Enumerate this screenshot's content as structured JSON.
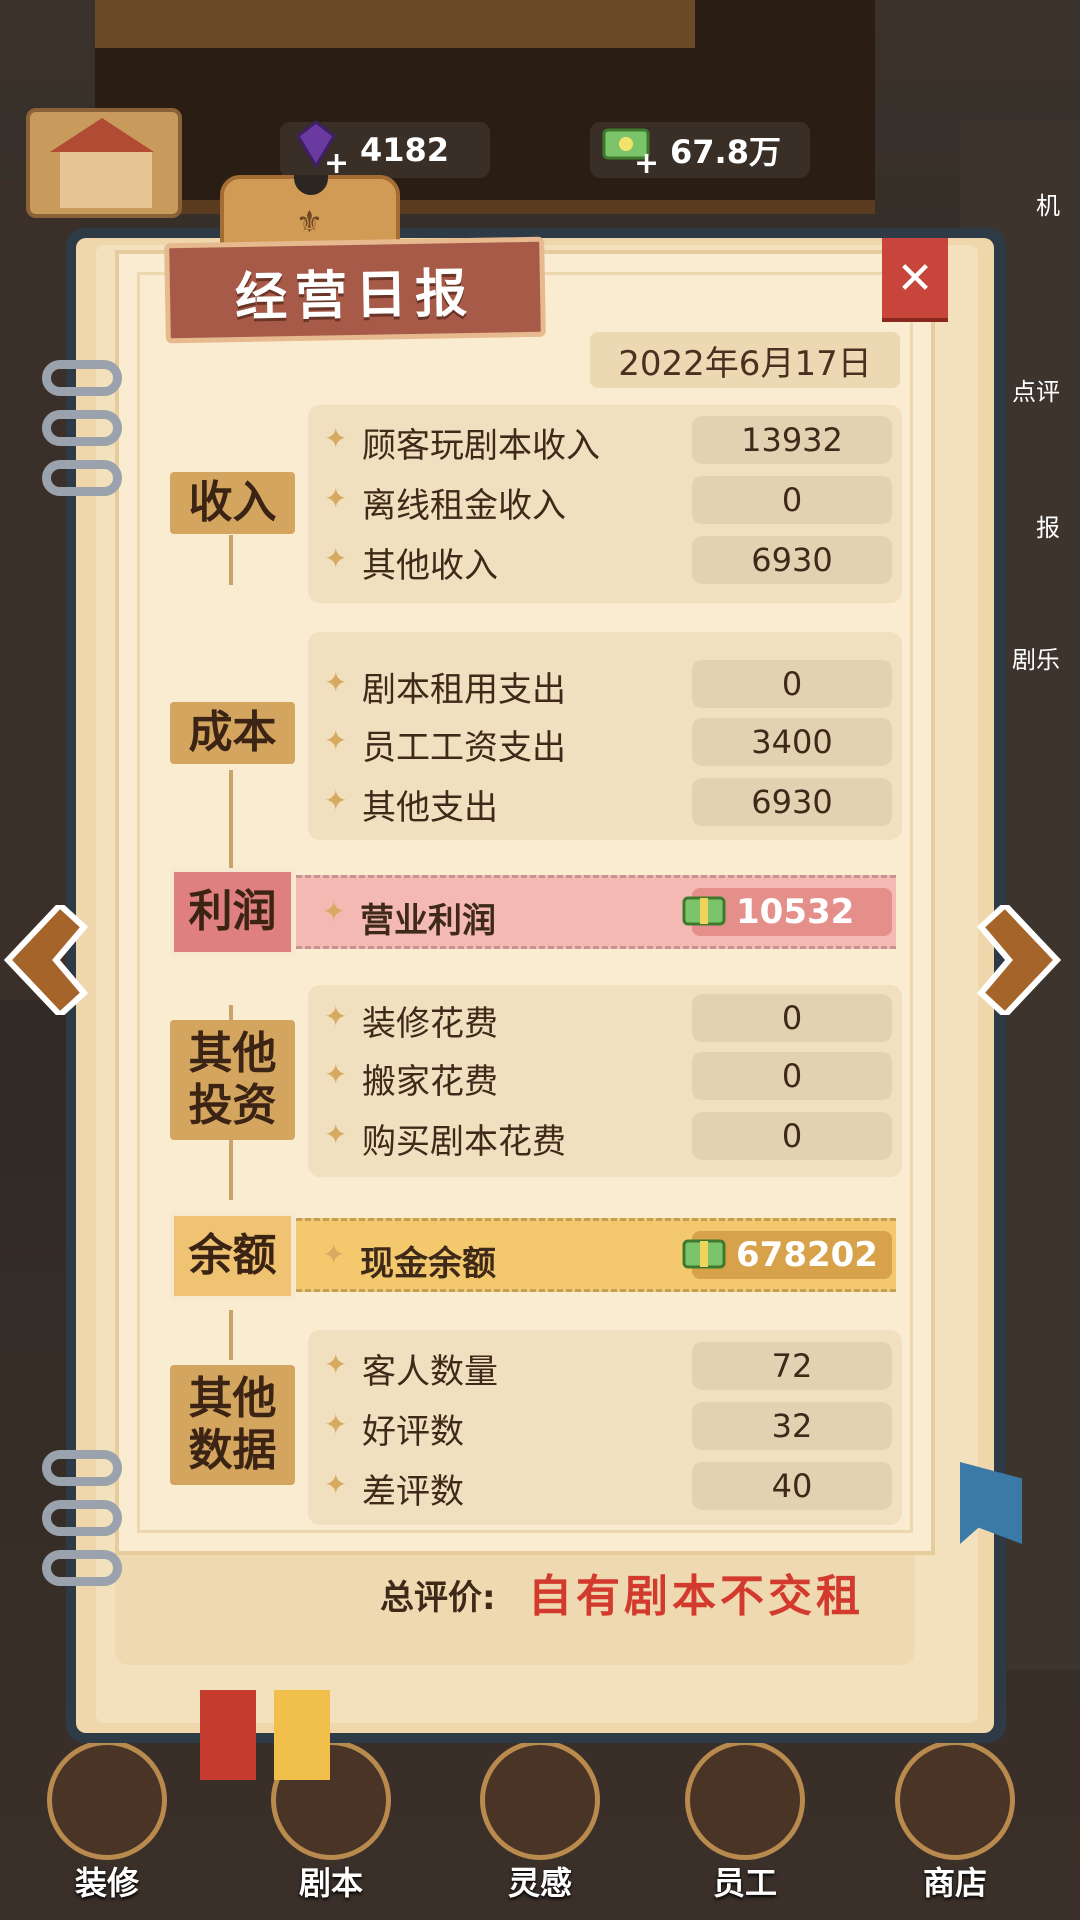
{
  "resources": {
    "gems": "4182",
    "cash": "67.8万"
  },
  "side_labels": [
    "机",
    "点评",
    "报",
    "剧乐"
  ],
  "report": {
    "title": "经营日报",
    "date": "2022年6月17日",
    "close_symbol": "✕",
    "sections": {
      "income": {
        "category": "收入",
        "rows": [
          {
            "label": "顾客玩剧本收入",
            "value": "13932"
          },
          {
            "label": "离线租金收入",
            "value": "0"
          },
          {
            "label": "其他收入",
            "value": "6930"
          }
        ]
      },
      "cost": {
        "category": "成本",
        "rows": [
          {
            "label": "剧本租用支出",
            "value": "0"
          },
          {
            "label": "员工工资支出",
            "value": "3400"
          },
          {
            "label": "其他支出",
            "value": "6930"
          }
        ]
      },
      "profit": {
        "category": "利润",
        "label": "营业利润",
        "value": "10532"
      },
      "investment": {
        "category": "其他投资",
        "rows": [
          {
            "label": "装修花费",
            "value": "0"
          },
          {
            "label": "搬家花费",
            "value": "0"
          },
          {
            "label": "购买剧本花费",
            "value": "0"
          }
        ]
      },
      "balance": {
        "category": "余额",
        "label": "现金余额",
        "value": "678202"
      },
      "other_data": {
        "category": "其他数据",
        "rows": [
          {
            "label": "客人数量",
            "value": "72"
          },
          {
            "label": "好评数",
            "value": "32"
          },
          {
            "label": "差评数",
            "value": "40"
          }
        ]
      }
    },
    "summary_label": "总评价:",
    "summary_verdict": "自有剧本不交租"
  },
  "bottom_nav": [
    {
      "label": "装修"
    },
    {
      "label": "剧本"
    },
    {
      "label": "灵感"
    },
    {
      "label": "员工"
    },
    {
      "label": "商店"
    }
  ],
  "colors": {
    "profit_band": "#f5b9b4",
    "balance_band": "#f4c96e",
    "verdict_red": "#d33a2e",
    "close_red": "#c7453b"
  }
}
